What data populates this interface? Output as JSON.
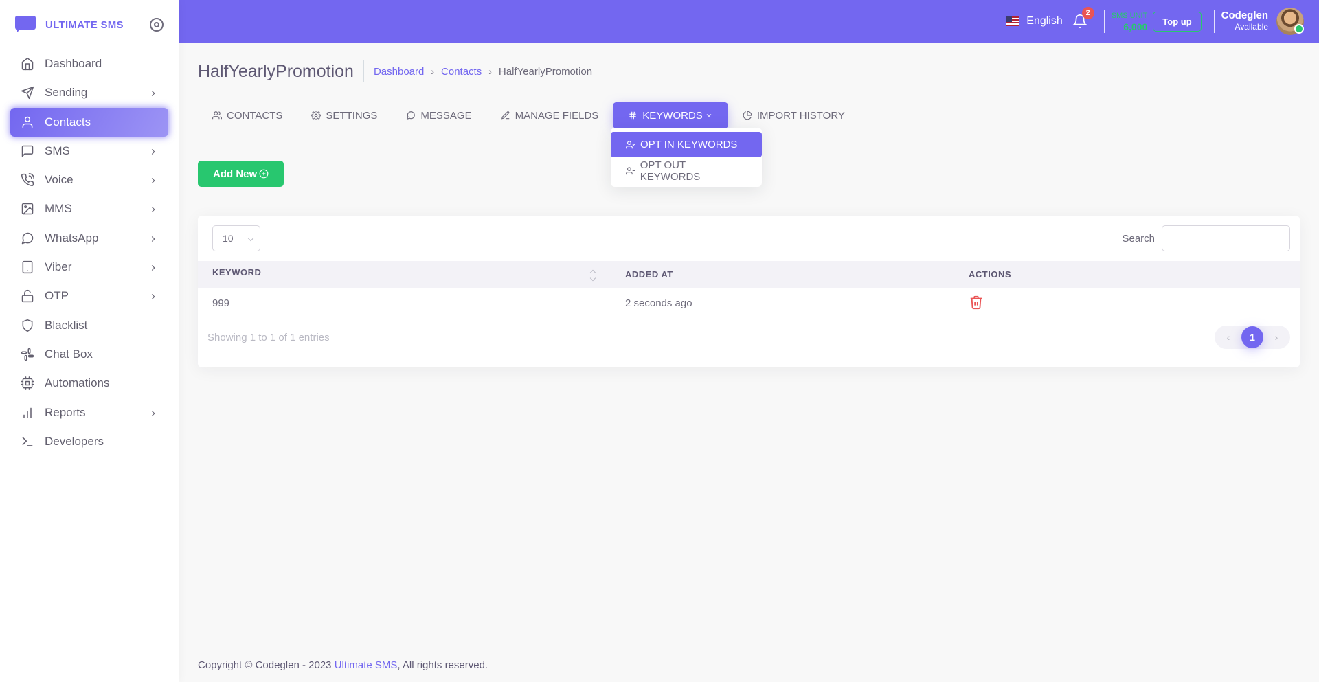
{
  "brand": {
    "name": "ULTIMATE SMS"
  },
  "sidebar": {
    "items": [
      {
        "label": "Dashboard",
        "icon": "home-icon",
        "chevron": false,
        "active": false
      },
      {
        "label": "Sending",
        "icon": "send-icon",
        "chevron": true,
        "active": false
      },
      {
        "label": "Contacts",
        "icon": "user-icon",
        "chevron": false,
        "active": true
      },
      {
        "label": "SMS",
        "icon": "message-square-icon",
        "chevron": true,
        "active": false
      },
      {
        "label": "Voice",
        "icon": "phone-call-icon",
        "chevron": true,
        "active": false
      },
      {
        "label": "MMS",
        "icon": "image-icon",
        "chevron": true,
        "active": false
      },
      {
        "label": "WhatsApp",
        "icon": "message-circle-icon",
        "chevron": true,
        "active": false
      },
      {
        "label": "Viber",
        "icon": "tablet-icon",
        "chevron": true,
        "active": false
      },
      {
        "label": "OTP",
        "icon": "unlock-icon",
        "chevron": true,
        "active": false
      },
      {
        "label": "Blacklist",
        "icon": "shield-icon",
        "chevron": false,
        "active": false
      },
      {
        "label": "Chat Box",
        "icon": "slack-icon",
        "chevron": false,
        "active": false
      },
      {
        "label": "Automations",
        "icon": "cpu-icon",
        "chevron": false,
        "active": false
      },
      {
        "label": "Reports",
        "icon": "bar-chart-icon",
        "chevron": true,
        "active": false
      },
      {
        "label": "Developers",
        "icon": "terminal-icon",
        "chevron": false,
        "active": false
      }
    ]
  },
  "navbar": {
    "language": "English",
    "notification_count": "2",
    "sms_unit_label": "SMS UNIT",
    "sms_unit_value": "6,000",
    "topup_label": "Top up",
    "user_name": "Codeglen",
    "user_status": "Available"
  },
  "page": {
    "title": "HalfYearlyPromotion",
    "breadcrumb": [
      "Dashboard",
      "Contacts",
      "HalfYearlyPromotion"
    ]
  },
  "tabs": [
    {
      "label": "CONTACTS",
      "icon": "users-icon"
    },
    {
      "label": "SETTINGS",
      "icon": "settings-icon"
    },
    {
      "label": "MESSAGE",
      "icon": "message-circle-icon"
    },
    {
      "label": "MANAGE FIELDS",
      "icon": "edit-icon"
    },
    {
      "label": "KEYWORDS",
      "icon": "hash-icon",
      "active": true
    },
    {
      "label": "IMPORT HISTORY",
      "icon": "pie-chart-icon"
    }
  ],
  "dropdown": {
    "items": [
      {
        "label": "OPT IN KEYWORDS",
        "active": true
      },
      {
        "label": "OPT OUT KEYWORDS",
        "active": false
      }
    ]
  },
  "add_new_label": "Add New",
  "table": {
    "page_length": "10",
    "search_label": "Search",
    "columns": [
      "KEYWORD",
      "ADDED AT",
      "ACTIONS"
    ],
    "rows": [
      {
        "keyword": "999",
        "added_at": "2 seconds ago"
      }
    ],
    "info": "Showing 1 to 1 of 1 entries",
    "current_page": "1"
  },
  "footer": {
    "text_before": "Copyright © Codeglen - 2023",
    "link": "Ultimate SMS",
    "text_after": ", All rights reserved."
  },
  "colors": {
    "primary": "#7367f0",
    "success": "#28c76f",
    "danger": "#ea5455"
  }
}
